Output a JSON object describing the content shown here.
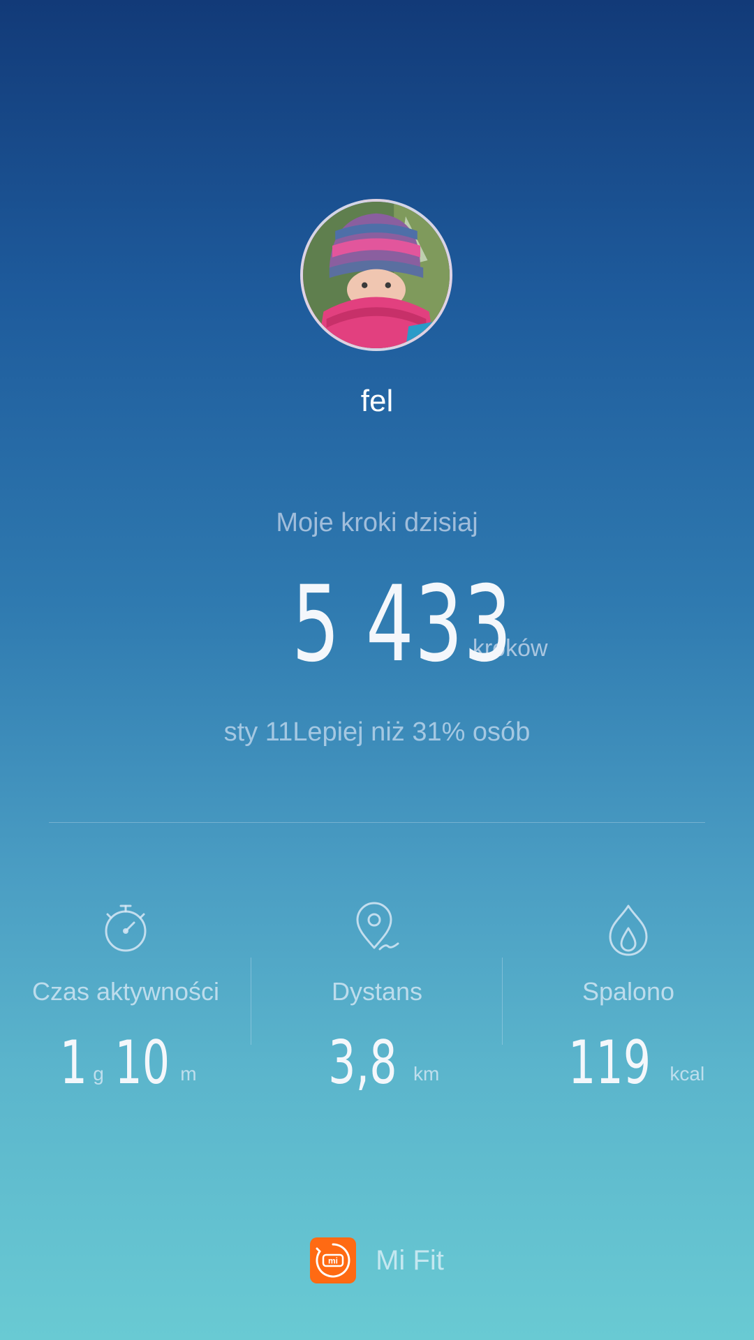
{
  "profile": {
    "username": "fel"
  },
  "steps": {
    "caption": "Moje kroki dzisiaj",
    "count": "5 433",
    "unit": "kroków",
    "date": "sty 11",
    "comparison": "Lepiej niż 31% osób"
  },
  "stats": {
    "active_time": {
      "icon": "stopwatch-icon",
      "label": "Czas aktywności",
      "hours": "1",
      "hours_unit": "g",
      "minutes": "10",
      "minutes_unit": "m"
    },
    "distance": {
      "icon": "location-pin-icon",
      "label": "Dystans",
      "value": "3,8",
      "unit": "km"
    },
    "calories": {
      "icon": "flame-icon",
      "label": "Spalono",
      "value": "119",
      "unit": "kcal"
    }
  },
  "footer": {
    "app_name": "Mi Fit",
    "logo_text": "mi"
  },
  "colors": {
    "background_top": "#123a78",
    "background_bottom": "#69cad3",
    "logo_orange": "#ff6a13"
  }
}
